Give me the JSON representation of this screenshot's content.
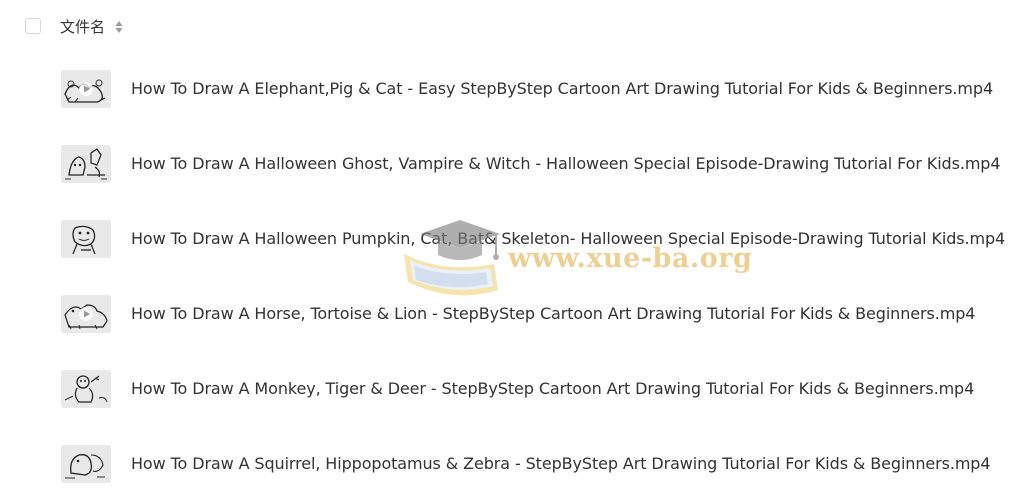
{
  "header": {
    "column_title": "文件名"
  },
  "files": [
    {
      "name": "How To Draw A Elephant,Pig & Cat - Easy StepByStep Cartoon Art Drawing Tutorial For Kids & Beginners.mp4",
      "thumb_icon": "video-thumbnail-play-icon"
    },
    {
      "name": "How To Draw A Halloween Ghost, Vampire & Witch - Halloween Special Episode-Drawing Tutorial For Kids.mp4",
      "thumb_icon": "video-thumbnail"
    },
    {
      "name": "How To Draw A Halloween Pumpkin, Cat, Bat& Skeleton- Halloween Special Episode-Drawing Tutorial Kids.mp4",
      "thumb_icon": "video-thumbnail"
    },
    {
      "name": "How To Draw A Horse, Tortoise & Lion - StepByStep Cartoon Art Drawing Tutorial For Kids & Beginners.mp4",
      "thumb_icon": "video-thumbnail-play-icon"
    },
    {
      "name": "How To Draw A Monkey, Tiger & Deer - StepByStep Cartoon Art Drawing Tutorial For Kids & Beginners.mp4",
      "thumb_icon": "video-thumbnail"
    },
    {
      "name": "How To Draw A Squirrel, Hippopotamus & Zebra - StepByStep Art Drawing Tutorial For Kids & Beginners.mp4",
      "thumb_icon": "video-thumbnail"
    }
  ],
  "watermark": {
    "text": "www.xue-ba.org"
  },
  "colors": {
    "text": "#333333",
    "checkbox_border": "#d7d7d7",
    "thumb_bg": "#e7e7e7",
    "watermark": "#deaa3c"
  }
}
